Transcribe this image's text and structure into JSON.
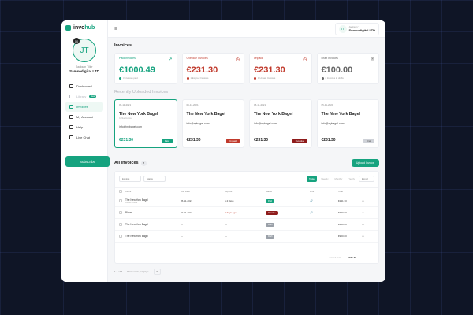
{
  "app": {
    "logo_prefix": "invo",
    "logo_suffix": "hub",
    "accent": "#16a37f"
  },
  "user": {
    "initials": "JT",
    "badge": "10",
    "name": "Jackson Tiller",
    "company": "Samsodigital LTD"
  },
  "nav": [
    {
      "label": "Dashboard",
      "state": "normal"
    },
    {
      "label": "Library",
      "state": "muted",
      "pill": "New"
    },
    {
      "label": "Invoices",
      "state": "active"
    },
    {
      "label": "My Account",
      "state": "normal"
    },
    {
      "label": "Help",
      "state": "normal"
    },
    {
      "label": "Live Chat",
      "state": "normal"
    }
  ],
  "subscribe_label": "Subscribe",
  "topbar": {
    "menu_icon": "≡",
    "initials": "JT",
    "name": "Jackson T",
    "company": "Samsodigital LTD"
  },
  "invoices_title": "Invoices",
  "summary_cards": [
    {
      "label": "Paid Invoices",
      "amount": "€1000.49",
      "sub": "3 Invoices paid",
      "color": "#16a37f",
      "icon": "↗"
    },
    {
      "label": "Overdue Invoices",
      "amount": "€231.30",
      "sub": "1 Expired Invoices",
      "color": "#c0392b",
      "icon": "◷"
    },
    {
      "label": "Unpaid",
      "amount": "€231.30",
      "sub": "1 Unpaid Invoices",
      "color": "#c0392b",
      "icon": "◷"
    },
    {
      "label": "Draft Invoices",
      "amount": "€100.00",
      "sub": "2 Invoices in drafts",
      "color": "#666666",
      "icon": "✉"
    }
  ],
  "recent_title": "Recently Uploaded Invoices",
  "recent_cards": [
    {
      "date": "05-11-2021",
      "title": "The New York Bagel",
      "sub": "Coffee Invoice",
      "email": "info@nybagel.com",
      "amount": "€231.30",
      "badge": "Paid",
      "badge_color": "#16a37f",
      "amount_color": "#16a37f",
      "selected": true
    },
    {
      "date": "05-11-2021",
      "title": "The New York Bagel",
      "sub": "",
      "email": "info@nybagel.com",
      "amount": "€231.30",
      "badge": "Unpaid",
      "badge_color": "#c0392b",
      "amount_color": "#222222",
      "selected": false
    },
    {
      "date": "05-11-2021",
      "title": "The New York Bagel",
      "sub": "",
      "email": "info@nybagel.com",
      "amount": "€231.30",
      "badge": "Overdue",
      "badge_color": "#8e1b1b",
      "amount_color": "#222222",
      "selected": false
    },
    {
      "date": "05-11-2021",
      "title": "The New York Bagel",
      "sub": "",
      "email": "info@nybagel.com",
      "amount": "€231.30",
      "badge": "Draft",
      "badge_color": "#cfd2d8",
      "amount_color": "#222222",
      "selected": false
    }
  ],
  "all_title": "All Invoices",
  "all_count": "8",
  "upload_label": "Upload Invoice",
  "filters": {
    "expires": "Expires",
    "status": "Status",
    "tabs": [
      "Today",
      "Weekly",
      "Monthly",
      "Yearly"
    ],
    "export": "Export"
  },
  "columns": [
    "Client",
    "Due Date",
    "Expires",
    "Status",
    "Link",
    "Total"
  ],
  "rows": [
    {
      "client": "The New York Bagel",
      "client_sub": "Coffee Invoice",
      "due": "05-11-2021",
      "expires": "6-3 days",
      "expires_color": "#444444",
      "status": "Paid",
      "status_color": "#16a37f",
      "link": "🔗",
      "total": "€231.30"
    },
    {
      "client": "Bloom",
      "client_sub": "",
      "due": "02-11-2021",
      "expires": "3 days ago",
      "expires_color": "#c0392b",
      "status": "Overdue",
      "status_color": "#8e1b1b",
      "link": "🔗",
      "total": "€340.00"
    },
    {
      "client": "The New York Bagel",
      "client_sub": "",
      "due": "---",
      "expires": "---",
      "expires_color": "#444444",
      "status": "Draft",
      "status_color": "#9aa0a8",
      "link": "",
      "total": "€450.00"
    },
    {
      "client": "The New York Bagel",
      "client_sub": "",
      "due": "---",
      "expires": "---",
      "expires_color": "#444444",
      "status": "Draft",
      "status_color": "#9aa0a8",
      "link": "",
      "total": "€900.00"
    }
  ],
  "grand_total_label": "Grand Total",
  "grand_total": "€921.30",
  "pagination": {
    "range": "1-4 of 4",
    "rows_label": "Show rows per page",
    "per_page": "5"
  }
}
